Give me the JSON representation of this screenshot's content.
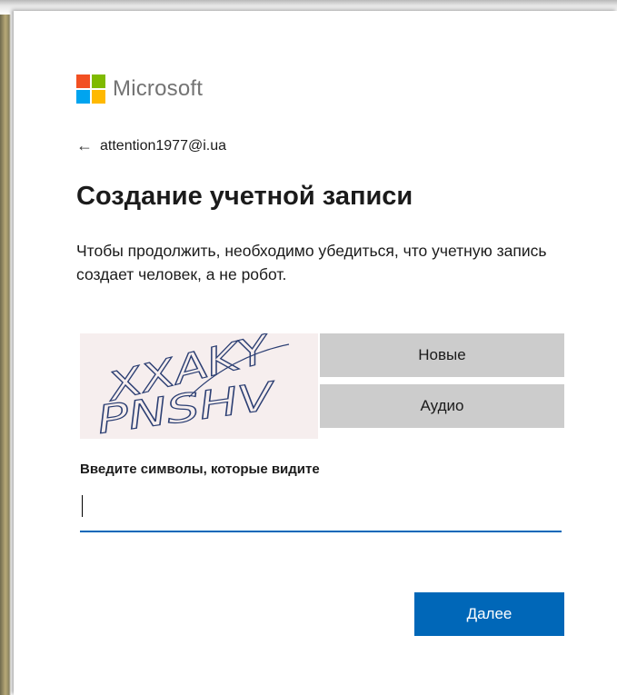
{
  "brand": {
    "name": "Microsoft",
    "logo_colors": [
      "#f25022",
      "#7fba00",
      "#00a4ef",
      "#ffb900"
    ]
  },
  "back": {
    "icon": "arrow-left-icon",
    "email": "attention1977@i.ua"
  },
  "page_title": "Создание учетной записи",
  "description": "Чтобы продолжить, необходимо убедиться, что учетную запись создает человек, а не робот.",
  "captcha": {
    "line1": "XXAKY",
    "line2": "PNSHV",
    "new_button_label": "Новые",
    "audio_button_label": "Аудио"
  },
  "input": {
    "label": "Введите символы, которые видите",
    "value": ""
  },
  "next_button_label": "Далее",
  "colors": {
    "accent": "#0067b8",
    "secondary_button": "#cccccc",
    "captcha_bg": "#f6eeee"
  }
}
